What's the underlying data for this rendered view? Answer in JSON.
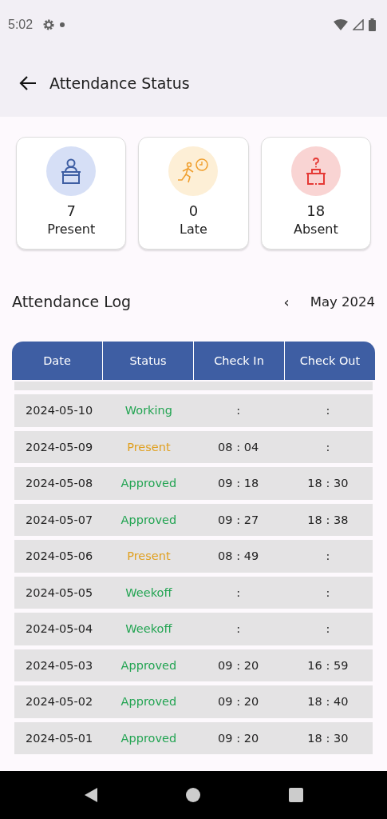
{
  "status_bar": {
    "time": "5:02"
  },
  "app_bar": {
    "title": "Attendance Status"
  },
  "summary": [
    {
      "kind": "present",
      "count": "7",
      "label": "Present"
    },
    {
      "kind": "late",
      "count": "0",
      "label": "Late"
    },
    {
      "kind": "absent",
      "count": "18",
      "label": "Absent"
    }
  ],
  "log": {
    "title": "Attendance Log",
    "prev": "‹",
    "month": "May 2024"
  },
  "table": {
    "columns": [
      "Date",
      "Status",
      "Check In",
      "Check Out"
    ],
    "rows": [
      {
        "date": "2024-05-10",
        "status": "Working",
        "color": "#22a452",
        "check_in": ":",
        "check_out": ":"
      },
      {
        "date": "2024-05-09",
        "status": "Present",
        "color": "#e0a020",
        "check_in": "08 : 04",
        "check_out": ":"
      },
      {
        "date": "2024-05-08",
        "status": "Approved",
        "color": "#22a452",
        "check_in": "09 : 18",
        "check_out": "18 : 30"
      },
      {
        "date": "2024-05-07",
        "status": "Approved",
        "color": "#22a452",
        "check_in": "09 : 27",
        "check_out": "18 : 38"
      },
      {
        "date": "2024-05-06",
        "status": "Present",
        "color": "#e0a020",
        "check_in": "08 : 49",
        "check_out": ":"
      },
      {
        "date": "2024-05-05",
        "status": "Weekoff",
        "color": "#22a452",
        "check_in": ":",
        "check_out": ":"
      },
      {
        "date": "2024-05-04",
        "status": "Weekoff",
        "color": "#22a452",
        "check_in": ":",
        "check_out": ":"
      },
      {
        "date": "2024-05-03",
        "status": "Approved",
        "color": "#22a452",
        "check_in": "09 : 20",
        "check_out": "16 : 59"
      },
      {
        "date": "2024-05-02",
        "status": "Approved",
        "color": "#22a452",
        "check_in": "09 : 20",
        "check_out": "18 : 40"
      },
      {
        "date": "2024-05-01",
        "status": "Approved",
        "color": "#22a452",
        "check_in": "09 : 20",
        "check_out": "18 : 30"
      }
    ]
  }
}
